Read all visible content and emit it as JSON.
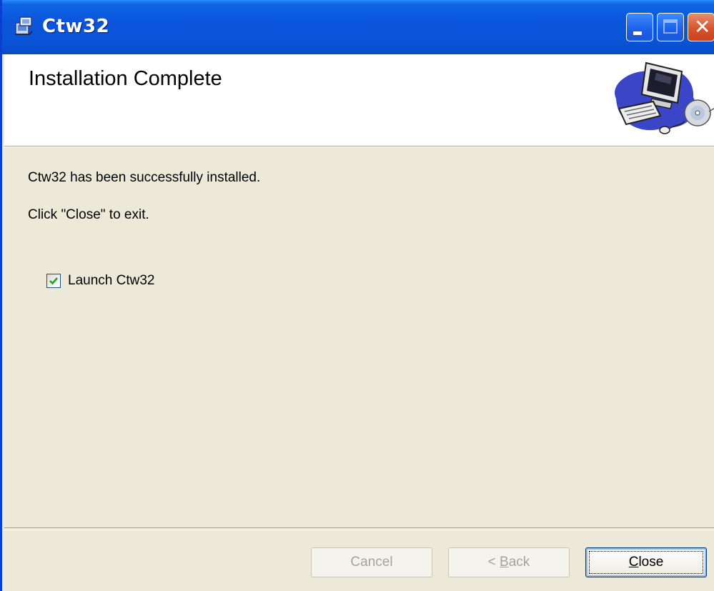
{
  "window": {
    "title": "Ctw32",
    "controls": {
      "minimize": "minimize",
      "maximize": "maximize",
      "close": "close"
    },
    "accent_color": "#0A55DB",
    "close_color": "#D6552D"
  },
  "banner": {
    "title": "Installation Complete",
    "graphic_icon": "computer-with-cd-icon"
  },
  "body": {
    "message": "Ctw32 has been successfully installed.",
    "instruction": "Click \"Close\" to exit.",
    "launch_checkbox": {
      "label": "Launch Ctw32",
      "checked": true
    }
  },
  "footer": {
    "cancel_label": "Cancel",
    "back_prefix": "< ",
    "back_mnemonic": "B",
    "back_rest": "ack",
    "close_mnemonic": "C",
    "close_rest": "lose"
  }
}
